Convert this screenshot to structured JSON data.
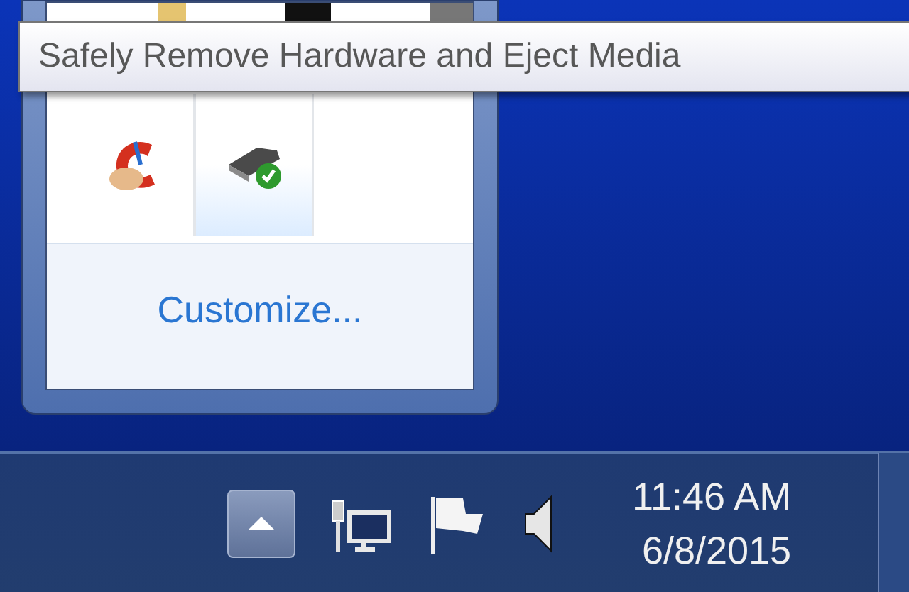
{
  "tooltip": {
    "text": "Safely Remove Hardware and Eject Media"
  },
  "overflow_panel": {
    "icons": [
      {
        "kind": "cleaner",
        "selected": false
      },
      {
        "kind": "usb",
        "selected": true
      }
    ],
    "link": "Customize..."
  },
  "taskbar": {
    "tray_icons": [
      {
        "kind": "network"
      },
      {
        "kind": "flag"
      },
      {
        "kind": "speaker"
      }
    ],
    "time": "11:46 AM",
    "date": "6/8/2015"
  }
}
